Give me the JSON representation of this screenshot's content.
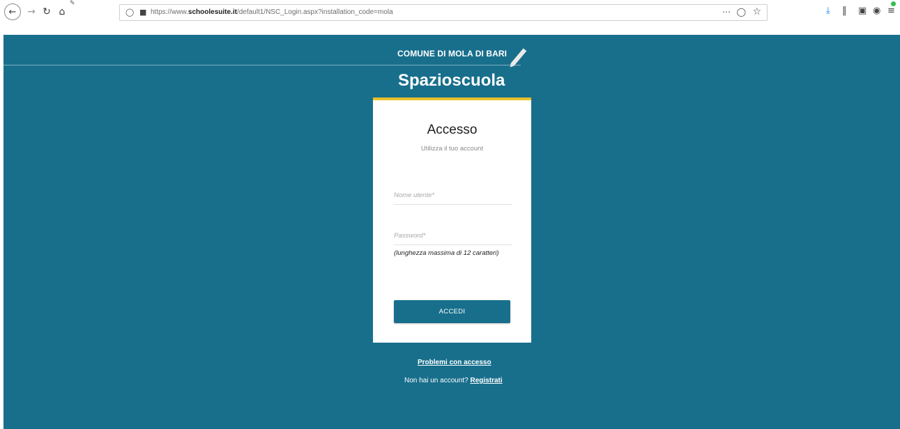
{
  "browser": {
    "url_prefix": "https://www.",
    "url_domain": "schoolesuite.it",
    "url_path": "/default1/NSC_Login.aspx?installation_code=mola",
    "icons": {
      "back": "arrow-left-icon",
      "forward": "arrow-right-icon",
      "reload": "reload-icon",
      "home": "home-icon",
      "shield": "shield-icon",
      "lock": "lock-icon",
      "more": "ellipsis-icon",
      "pocket": "pocket-icon",
      "bookmark": "star-icon",
      "download": "download-icon",
      "library": "library-icon",
      "sidebar": "sidebar-icon",
      "account": "account-icon",
      "menu": "menu-icon"
    }
  },
  "header": {
    "municipality": "COMUNE DI MOLA DI BARI",
    "brand": "Spazioscuola"
  },
  "login": {
    "title": "Accesso",
    "subtitle": "Utilizza il tuo account",
    "username_placeholder": "Nome utente*",
    "password_placeholder": "Password*",
    "password_hint": "(lunghezza massima di 12 caratteri)",
    "submit_label": "ACCEDI"
  },
  "footer": {
    "problems_link": "Problemi con accesso",
    "no_account_text": "Non hai un account? ",
    "register_link": "Registrati"
  },
  "colors": {
    "page_background": "#186f8c",
    "card_accent": "#e8c02b",
    "button": "#186f8c"
  }
}
